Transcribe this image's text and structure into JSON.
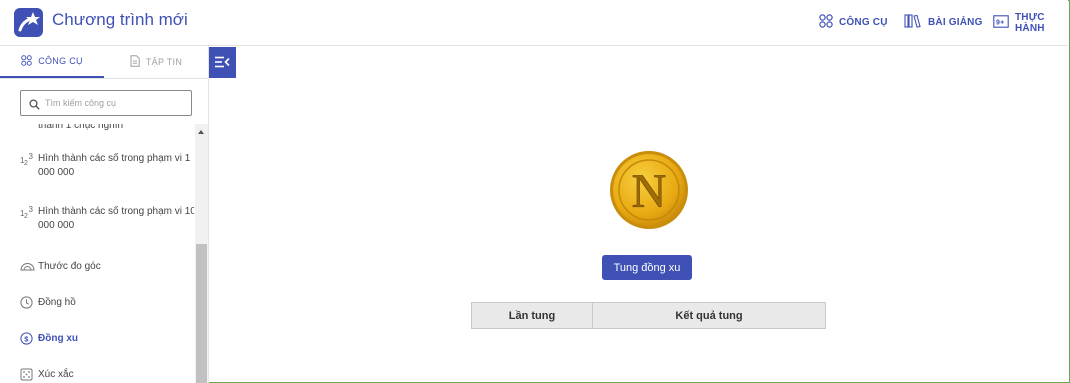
{
  "app": {
    "title": "Chương trình mới",
    "brand_color": "#3f51b5"
  },
  "top_nav": [
    {
      "label": "CÔNG CỤ",
      "icon": "tools-grid-icon"
    },
    {
      "label": "BÀI GIẢNG",
      "icon": "books-icon"
    },
    {
      "label": "THỰC HÀNH",
      "icon": "practice-icon"
    }
  ],
  "sidebar": {
    "tabs": [
      {
        "label": "CÔNG CỤ",
        "icon": "tools-grid-icon",
        "active": true
      },
      {
        "label": "TẬP TIN",
        "icon": "file-icon",
        "active": false
      }
    ],
    "search": {
      "placeholder": "Tìm kiếm công cụ",
      "value": ""
    },
    "partial_item": "thành 1 chục nghìn",
    "items": [
      {
        "label": "Hình thành các số trong phạm vi 1 000 000",
        "icon": "number-123-icon",
        "active": false
      },
      {
        "label": "Hình thành các số trong phạm vi 10 000 000",
        "icon": "number-123-icon",
        "active": false
      },
      {
        "label": "Thước đo góc",
        "icon": "protractor-icon",
        "active": false
      },
      {
        "label": "Đồng hồ",
        "icon": "clock-icon",
        "active": false
      },
      {
        "label": "Đồng xu",
        "icon": "coin-icon",
        "active": true
      },
      {
        "label": "Xúc xắc",
        "icon": "dice-icon",
        "active": false
      }
    ]
  },
  "main": {
    "coin_face": "N",
    "toss_button": "Tung đồng xu",
    "table": {
      "headers": [
        "Lần tung",
        "Kết quả tung"
      ],
      "rows": []
    }
  }
}
